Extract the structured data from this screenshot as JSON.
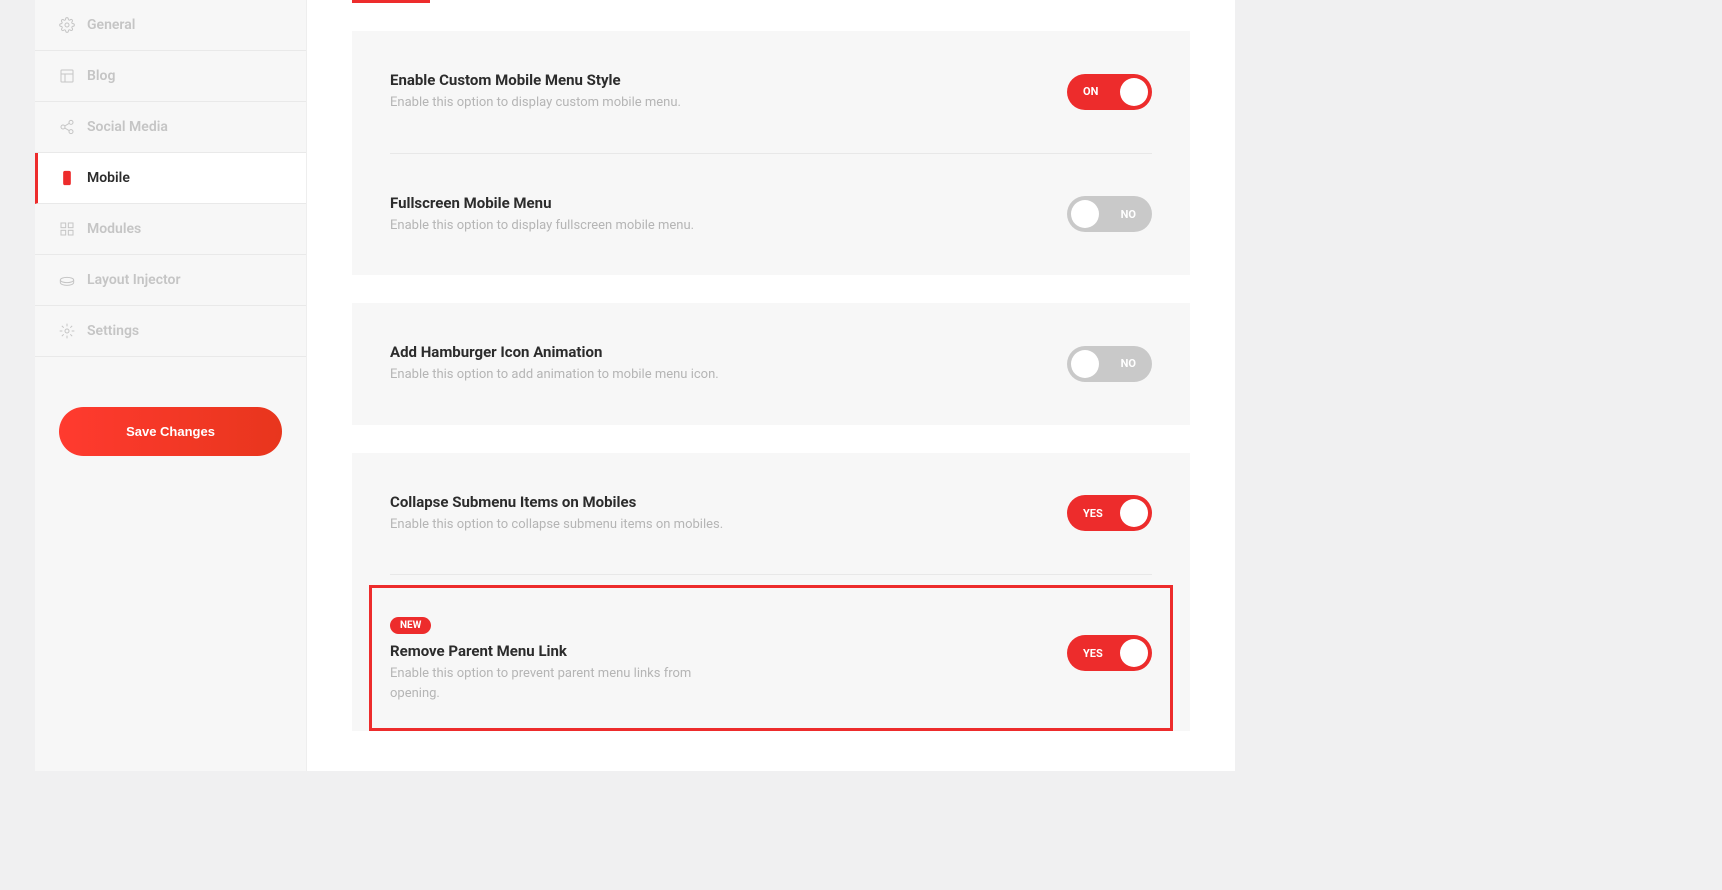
{
  "sidebar": {
    "items": [
      {
        "label": "General",
        "icon": "gear-icon"
      },
      {
        "label": "Blog",
        "icon": "grid-icon"
      },
      {
        "label": "Social Media",
        "icon": "share-icon"
      },
      {
        "label": "Mobile",
        "icon": "mobile-icon"
      },
      {
        "label": "Modules",
        "icon": "modules-icon"
      },
      {
        "label": "Layout Injector",
        "icon": "layout-icon"
      },
      {
        "label": "Settings",
        "icon": "cog-icon"
      }
    ],
    "save_button": "Save Changes"
  },
  "settings": {
    "groups": [
      {
        "rows": [
          {
            "title": "Enable Custom Mobile Menu Style",
            "desc": "Enable this option to display custom mobile menu.",
            "toggle": {
              "on": true,
              "label": "ON"
            }
          },
          {
            "title": "Fullscreen Mobile Menu",
            "desc": "Enable this option to display fullscreen mobile menu.",
            "toggle": {
              "on": false,
              "label": "NO"
            }
          }
        ]
      },
      {
        "rows": [
          {
            "title": "Add Hamburger Icon Animation",
            "desc": "Enable this option to add animation to mobile menu icon.",
            "toggle": {
              "on": false,
              "label": "NO"
            }
          }
        ]
      },
      {
        "rows": [
          {
            "title": "Collapse Submenu Items on Mobiles",
            "desc": "Enable this option to collapse submenu items on mobiles.",
            "toggle": {
              "on": true,
              "label": "YES"
            }
          },
          {
            "badge": "NEW",
            "title": "Remove Parent Menu Link",
            "desc": "Enable this option to prevent parent menu links from opening.",
            "toggle": {
              "on": true,
              "label": "YES"
            },
            "highlighted": true
          }
        ]
      }
    ]
  }
}
